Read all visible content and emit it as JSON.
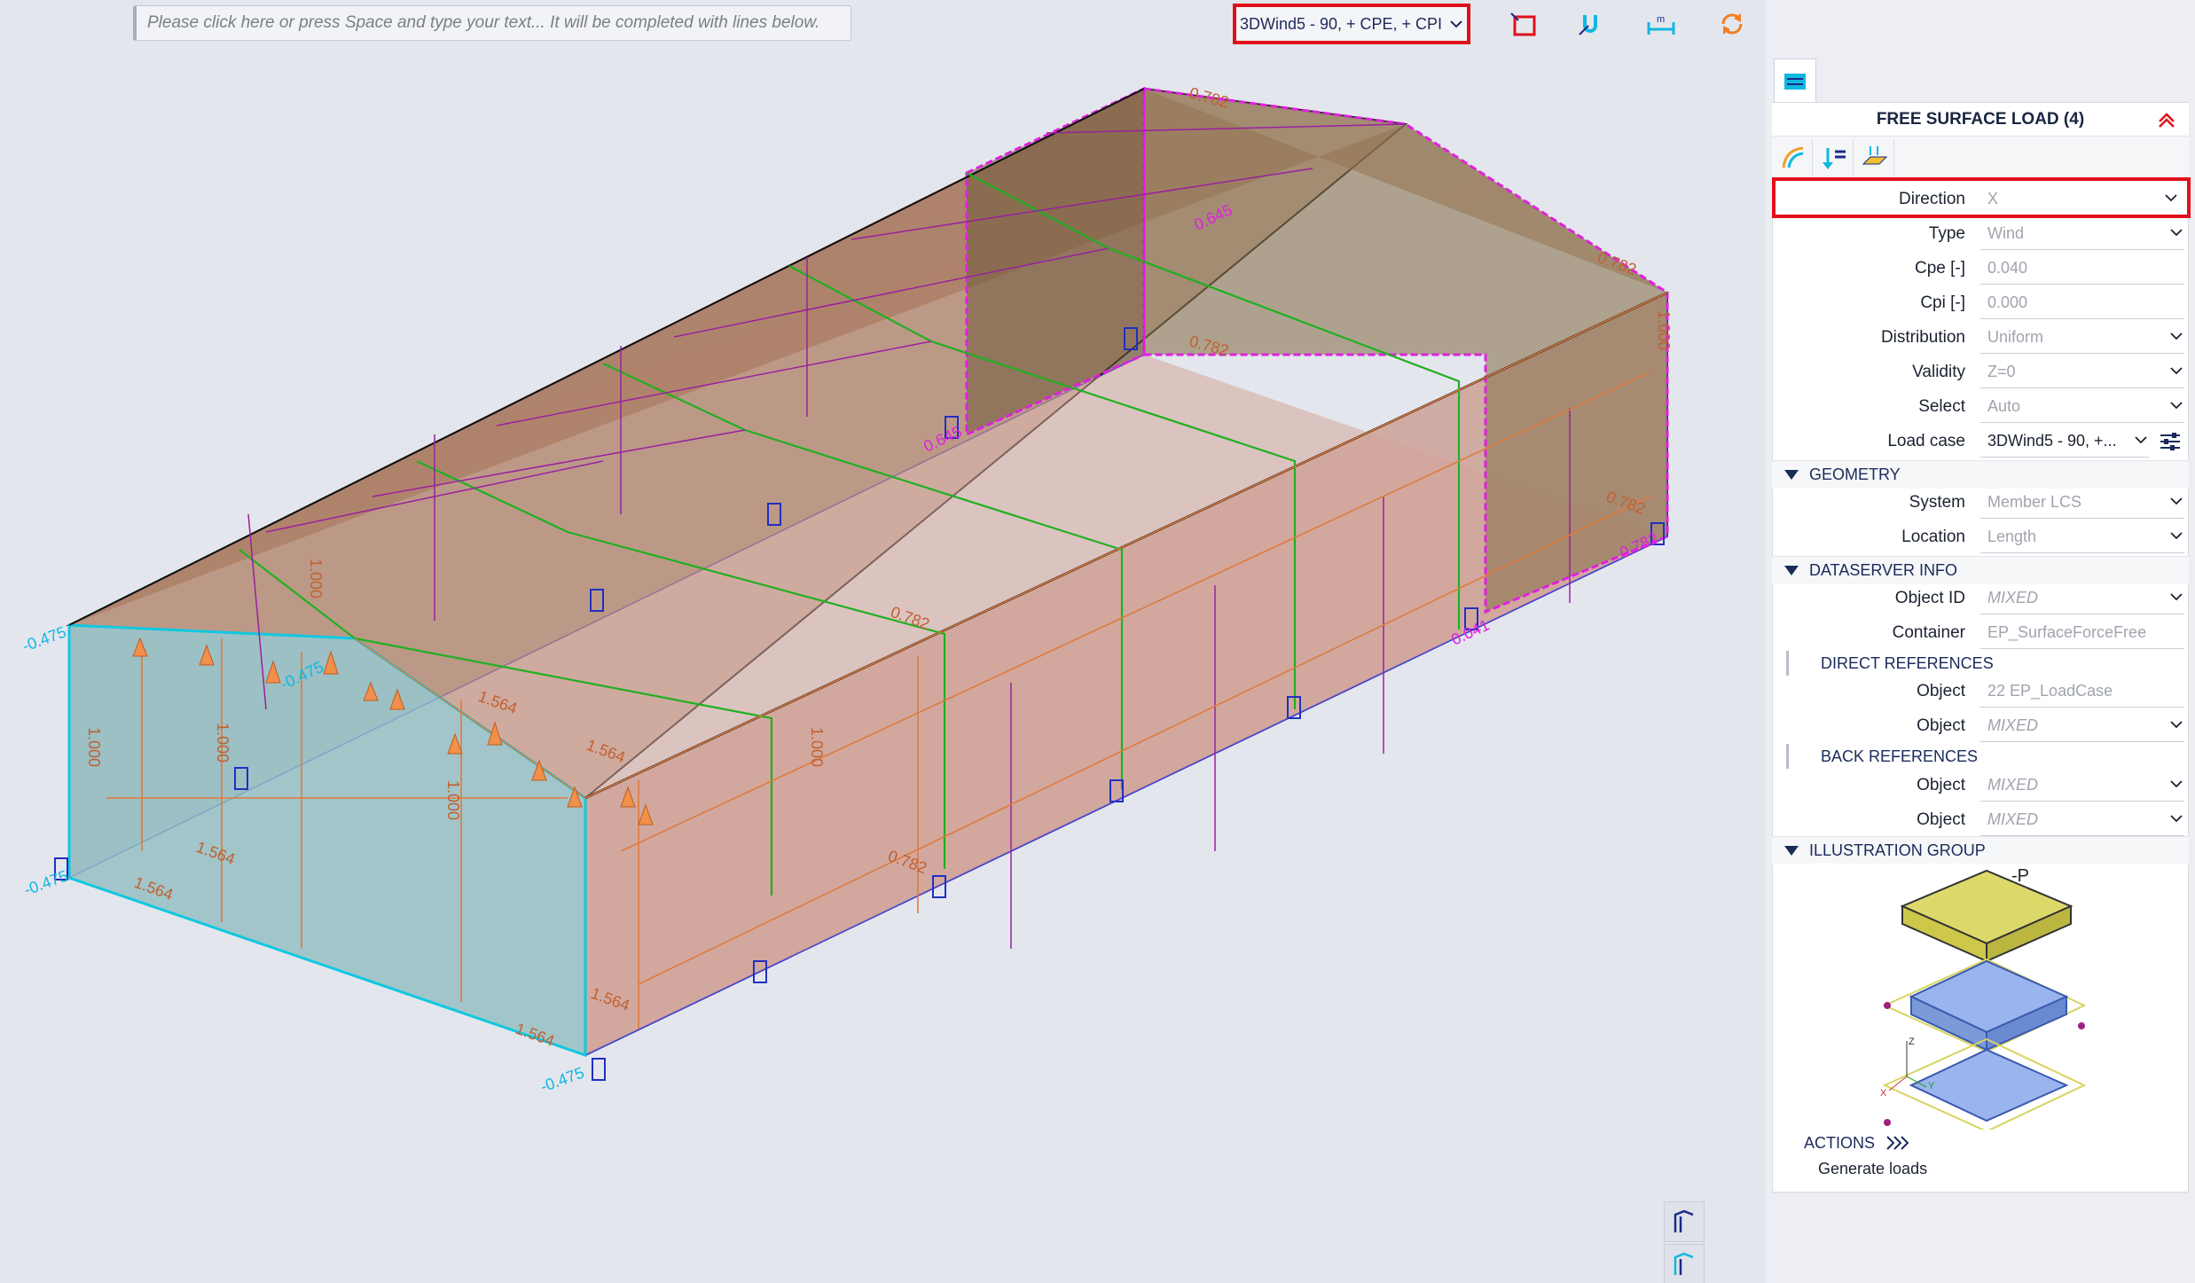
{
  "command_bar": {
    "placeholder": "Please click here or press Space and type your text... It will be completed with lines below."
  },
  "toolbar": {
    "loadcase_selector": "3DWind5 - 90, + CPE, + CPI",
    "icons": [
      "rectangle-select-icon",
      "magnet-snap-icon",
      "dimension-icon",
      "refresh-icon",
      "structure-lock-icon",
      "grid-lock-icon",
      "zoom-fit-icon",
      "eu-flag-icon",
      "eu-flag-icon",
      "user-settings-icon"
    ]
  },
  "viewport": {
    "labels": {
      "left_a": "-0.475",
      "left_b": "-0.475",
      "left_c": "-0.475",
      "left_d": "-0.475",
      "mid_a": "-0.475",
      "gable_a": "1.564",
      "gable_b": "1.564",
      "gable_c": "1.564",
      "wall_a": "1.564",
      "wall_b": "1.564",
      "wall_c": "0.782",
      "wall_d": "0.782",
      "top_a": "0.782",
      "top_b": "0.782",
      "top_c": "0.645",
      "top_d": "0.645",
      "right_a": "0.782",
      "right_b": "0.782",
      "right_c": "0.041",
      "right_d": "0.782",
      "v1": "1.000",
      "v2": "1.000",
      "v3": "1.000",
      "v4": "1.000",
      "v5": "1.000",
      "v6": "1.000"
    }
  },
  "panel": {
    "title": "FREE SURFACE LOAD (4)",
    "properties": [
      {
        "label": "Direction",
        "value": "X"
      },
      {
        "label": "Type",
        "value": "Wind"
      },
      {
        "label": "Cpe [-]",
        "value": "0.040"
      },
      {
        "label": "Cpi [-]",
        "value": "0.000"
      },
      {
        "label": "Distribution",
        "value": "Uniform"
      },
      {
        "label": "Validity",
        "value": "Z=0"
      },
      {
        "label": "Select",
        "value": "Auto"
      },
      {
        "label": "Load case",
        "value": "3DWind5 - 90, +..."
      }
    ],
    "geometry": {
      "header": "GEOMETRY",
      "rows": [
        {
          "label": "System",
          "value": "Member LCS"
        },
        {
          "label": "Location",
          "value": "Length"
        }
      ]
    },
    "dataserver": {
      "header": "DATASERVER INFO",
      "rows": [
        {
          "label": "Object ID",
          "value": "MIXED"
        },
        {
          "label": "Container",
          "value": "EP_SurfaceForceFree"
        }
      ],
      "direct_header": "DIRECT REFERENCES",
      "direct_rows": [
        {
          "label": "Object",
          "value": "22 EP_LoadCase"
        },
        {
          "label": "Object",
          "value": "MIXED"
        }
      ],
      "back_header": "BACK REFERENCES",
      "back_rows": [
        {
          "label": "Object",
          "value": "MIXED"
        },
        {
          "label": "Object",
          "value": "MIXED"
        }
      ]
    },
    "illustration": {
      "header": "ILLUSTRATION GROUP",
      "p_label": "-P",
      "axis_z": "Z",
      "axis_x": "X",
      "axis_y": "Y"
    },
    "actions": {
      "header": "ACTIONS",
      "generate": "Generate loads"
    }
  },
  "colors": {
    "highlight": "#e0101a",
    "load_orange": "#e07a3a",
    "magenta": "#e020e0",
    "cyan": "#10c8e0",
    "green": "#20b020",
    "blue": "#2030c0"
  }
}
